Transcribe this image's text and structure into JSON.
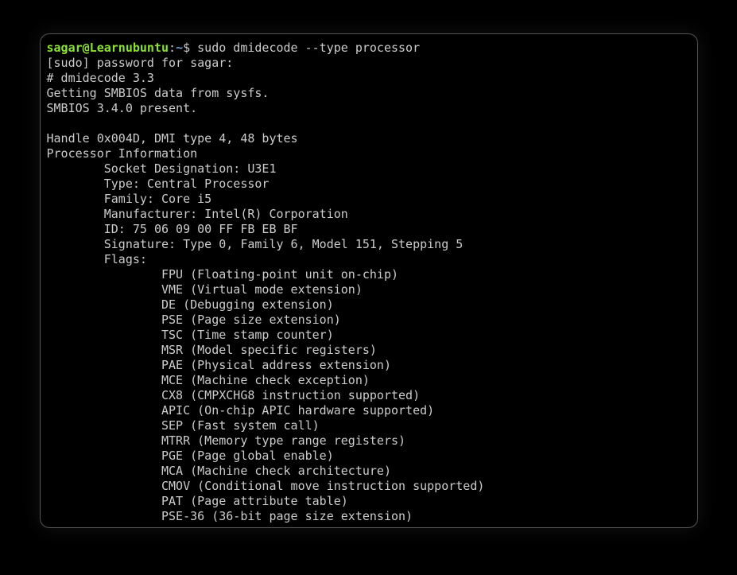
{
  "prompt": {
    "user_host": "sagar@Learnubuntu",
    "separator": ":",
    "path": "~",
    "symbol": "$"
  },
  "command": " sudo dmidecode --type processor",
  "output": {
    "line1": "[sudo] password for sagar:",
    "line2": "# dmidecode 3.3",
    "line3": "Getting SMBIOS data from sysfs.",
    "line4": "SMBIOS 3.4.0 present.",
    "line5": "",
    "line6": "Handle 0x004D, DMI type 4, 48 bytes",
    "line7": "Processor Information",
    "line8": "        Socket Designation: U3E1",
    "line9": "        Type: Central Processor",
    "line10": "        Family: Core i5",
    "line11": "        Manufacturer: Intel(R) Corporation",
    "line12": "        ID: 75 06 09 00 FF FB EB BF",
    "line13": "        Signature: Type 0, Family 6, Model 151, Stepping 5",
    "line14": "        Flags:",
    "line15": "                FPU (Floating-point unit on-chip)",
    "line16": "                VME (Virtual mode extension)",
    "line17": "                DE (Debugging extension)",
    "line18": "                PSE (Page size extension)",
    "line19": "                TSC (Time stamp counter)",
    "line20": "                MSR (Model specific registers)",
    "line21": "                PAE (Physical address extension)",
    "line22": "                MCE (Machine check exception)",
    "line23": "                CX8 (CMPXCHG8 instruction supported)",
    "line24": "                APIC (On-chip APIC hardware supported)",
    "line25": "                SEP (Fast system call)",
    "line26": "                MTRR (Memory type range registers)",
    "line27": "                PGE (Page global enable)",
    "line28": "                MCA (Machine check architecture)",
    "line29": "                CMOV (Conditional move instruction supported)",
    "line30": "                PAT (Page attribute table)",
    "line31": "                PSE-36 (36-bit page size extension)"
  }
}
